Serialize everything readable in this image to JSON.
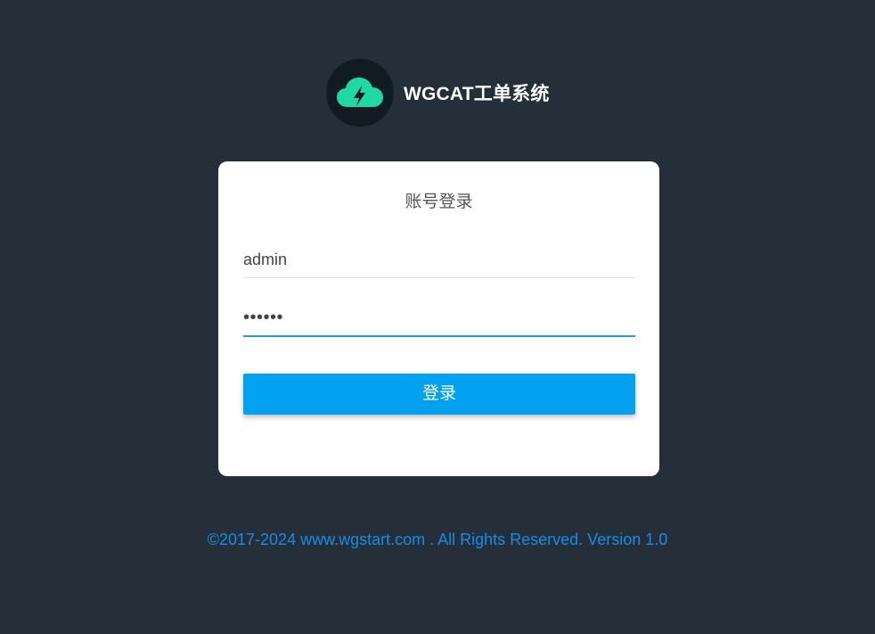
{
  "brand": {
    "title": "WGCAT工单系统",
    "logo_icon": "cloud-lightning-icon"
  },
  "login": {
    "heading": "账号登录",
    "username_value": "admin",
    "password_value": "••••••",
    "submit_label": "登录"
  },
  "footer": {
    "copyright": "©2017-2024 www.wgstart.com . All Rights Reserved. Version 1.0"
  },
  "colors": {
    "background": "#252f39",
    "accent": "#03a2f0",
    "logo_green": "#1fd8a6",
    "footer_link": "#1a8ae6"
  }
}
